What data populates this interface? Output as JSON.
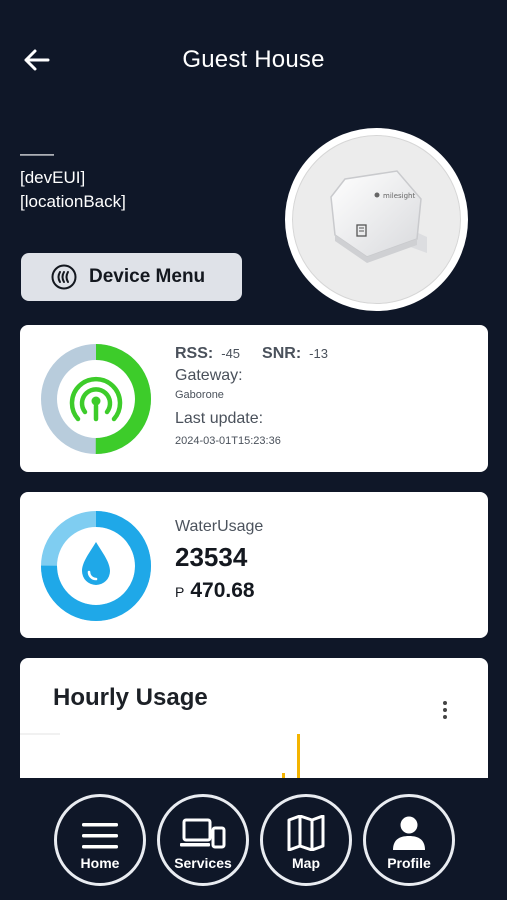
{
  "header": {
    "title": "Guest House"
  },
  "device": {
    "name_placeholder": "——",
    "dev_eui": "[devEUI]",
    "location": "[locationBack]"
  },
  "menu_button": {
    "label": "Device Menu"
  },
  "signal": {
    "rss_label": "RSS:",
    "rss_value": "-45",
    "snr_label": "SNR:",
    "snr_value": "-13",
    "gateway_label": "Gateway:",
    "gateway_value": "Gaborone",
    "last_update_label": "Last update:",
    "last_update_value": "2024-03-01T15:23:36",
    "ring_fill_fraction": 0.5,
    "colors": {
      "fill": "#3dcc2a",
      "track": "#b8ccdc"
    }
  },
  "water": {
    "label": "WaterUsage",
    "value": "23534",
    "currency": "P",
    "cost": "470.68",
    "ring_fill_fraction": 0.75,
    "colors": {
      "fill": "#1fa8e8",
      "track": "#7fcdf1"
    }
  },
  "chart": {
    "title": "Hourly Usage",
    "bar_color": "#f4b400"
  },
  "nav": {
    "items": [
      {
        "label": "Home",
        "icon": "menu-icon"
      },
      {
        "label": "Services",
        "icon": "devices-icon"
      },
      {
        "label": "Map",
        "icon": "map-icon"
      },
      {
        "label": "Profile",
        "icon": "person-icon"
      }
    ]
  },
  "colors": {
    "background": "#0f1728",
    "card": "#ffffff",
    "button": "#dfe2e8"
  }
}
